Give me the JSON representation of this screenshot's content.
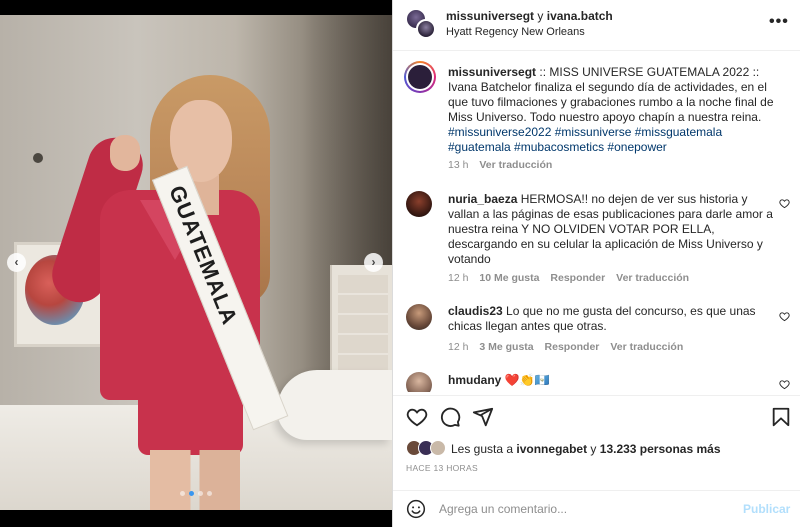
{
  "media": {
    "sash_text": "GUATEMALA",
    "nav_prev_icon": "chevron-left-icon",
    "nav_next_icon": "chevron-right-icon",
    "carousel": {
      "count": 4,
      "active_index": 1
    },
    "nav_prev_glyph": "‹",
    "nav_next_glyph": "›"
  },
  "header": {
    "user1": "missuniversegt",
    "sep": "y",
    "user2": "ivana.batch",
    "location": "Hyatt Regency New Orleans",
    "more_glyph": "•••"
  },
  "post": {
    "username": "missuniversegt",
    "caption": ":: MISS UNIVERSE GUATEMALA 2022 :: Ivana Batchelor finaliza el segundo día de actividades, en el que tuvo filmaciones y grabaciones rumbo a la noche final de Miss Universo. Todo nuestro apoyo chapín a nuestra reina.",
    "hashtags": "#missuniverse2022 #missuniverse #missguatemala #guatemala #mubacosmetics #onepower",
    "time": "13 h",
    "see_translation": "Ver traducción"
  },
  "comments": [
    {
      "username": "nuria_baeza",
      "text": "HERMOSA!! no dejen de ver sus historia y vallan a las páginas de esas publicaciones para darle amor a nuestra reina Y NO OLVIDEN VOTAR POR ELLA, descargando en su celular la aplicación de Miss Universo y votando",
      "time": "12 h",
      "likes": "10 Me gusta",
      "reply": "Responder",
      "see_translation": "Ver traducción"
    },
    {
      "username": "claudis23",
      "text": "Lo que no me gusta del concurso, es que unas chicas llegan antes que otras.",
      "time": "12 h",
      "likes": "3 Me gusta",
      "reply": "Responder",
      "see_translation": "Ver traducción"
    },
    {
      "username": "hmudany",
      "text": "❤️👏🇬🇹"
    }
  ],
  "likes": {
    "prefix": "Les gusta a",
    "user": "ivonnegabet",
    "conj": "y",
    "count": "13.233 personas más"
  },
  "time_ago": "HACE 13 HORAS",
  "comment_box": {
    "placeholder": "Agrega un comentario...",
    "publish": "Publicar"
  },
  "colors": {
    "link": "#00376b",
    "muted": "#8e8e8e",
    "publish_disabled": "#b2dffc",
    "carousel_active": "#3897f0"
  }
}
